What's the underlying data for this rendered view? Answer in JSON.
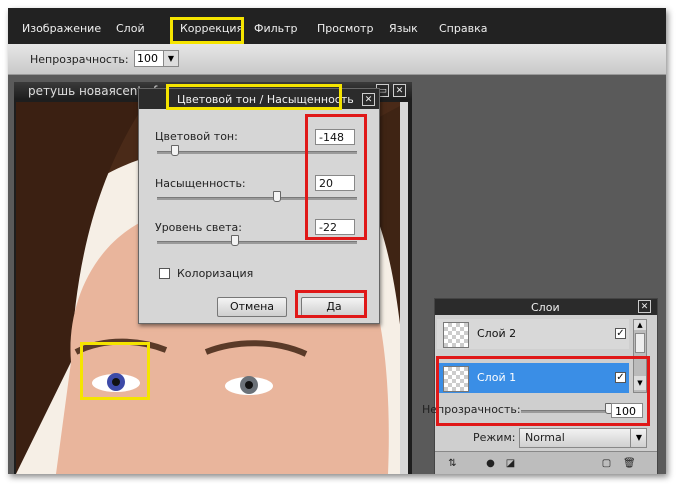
{
  "menu": {
    "items": [
      "Изображение",
      "Слой",
      "Коррекция",
      "Фильтр",
      "Просмотр",
      "Язык",
      "Справка"
    ]
  },
  "toolbar": {
    "opacity_label": "Непрозрачность:",
    "opacity_value": "100"
  },
  "document": {
    "title": "ретушь новаясentr_fre"
  },
  "dialog": {
    "title": "Цветовой тон / Насыщенность",
    "hue_label": "Цветовой тон:",
    "hue_value": "-148",
    "hue_level": 0.09,
    "saturation_label": "Насыщенность:",
    "saturation_value": "20",
    "saturation_level": 0.6,
    "lightness_label": "Уровень света:",
    "lightness_value": "-22",
    "lightness_level": 0.39,
    "colorize_label": "Колоризация",
    "cancel_label": "Отмена",
    "ok_label": "Да"
  },
  "layers_panel": {
    "title": "Слои",
    "layers": [
      {
        "name": "Слой 2",
        "visible": true,
        "selected": false
      },
      {
        "name": "Слой 1",
        "visible": true,
        "selected": true
      }
    ],
    "opacity_label": "Непрозрачность:",
    "opacity_value": "100",
    "opacity_level": 1.0,
    "mode_label": "Режим:",
    "mode_value": "Normal"
  },
  "colors": {
    "highlight_yellow": "#f5e400",
    "highlight_red": "#e01818",
    "selected_layer": "#3a8ee6"
  }
}
